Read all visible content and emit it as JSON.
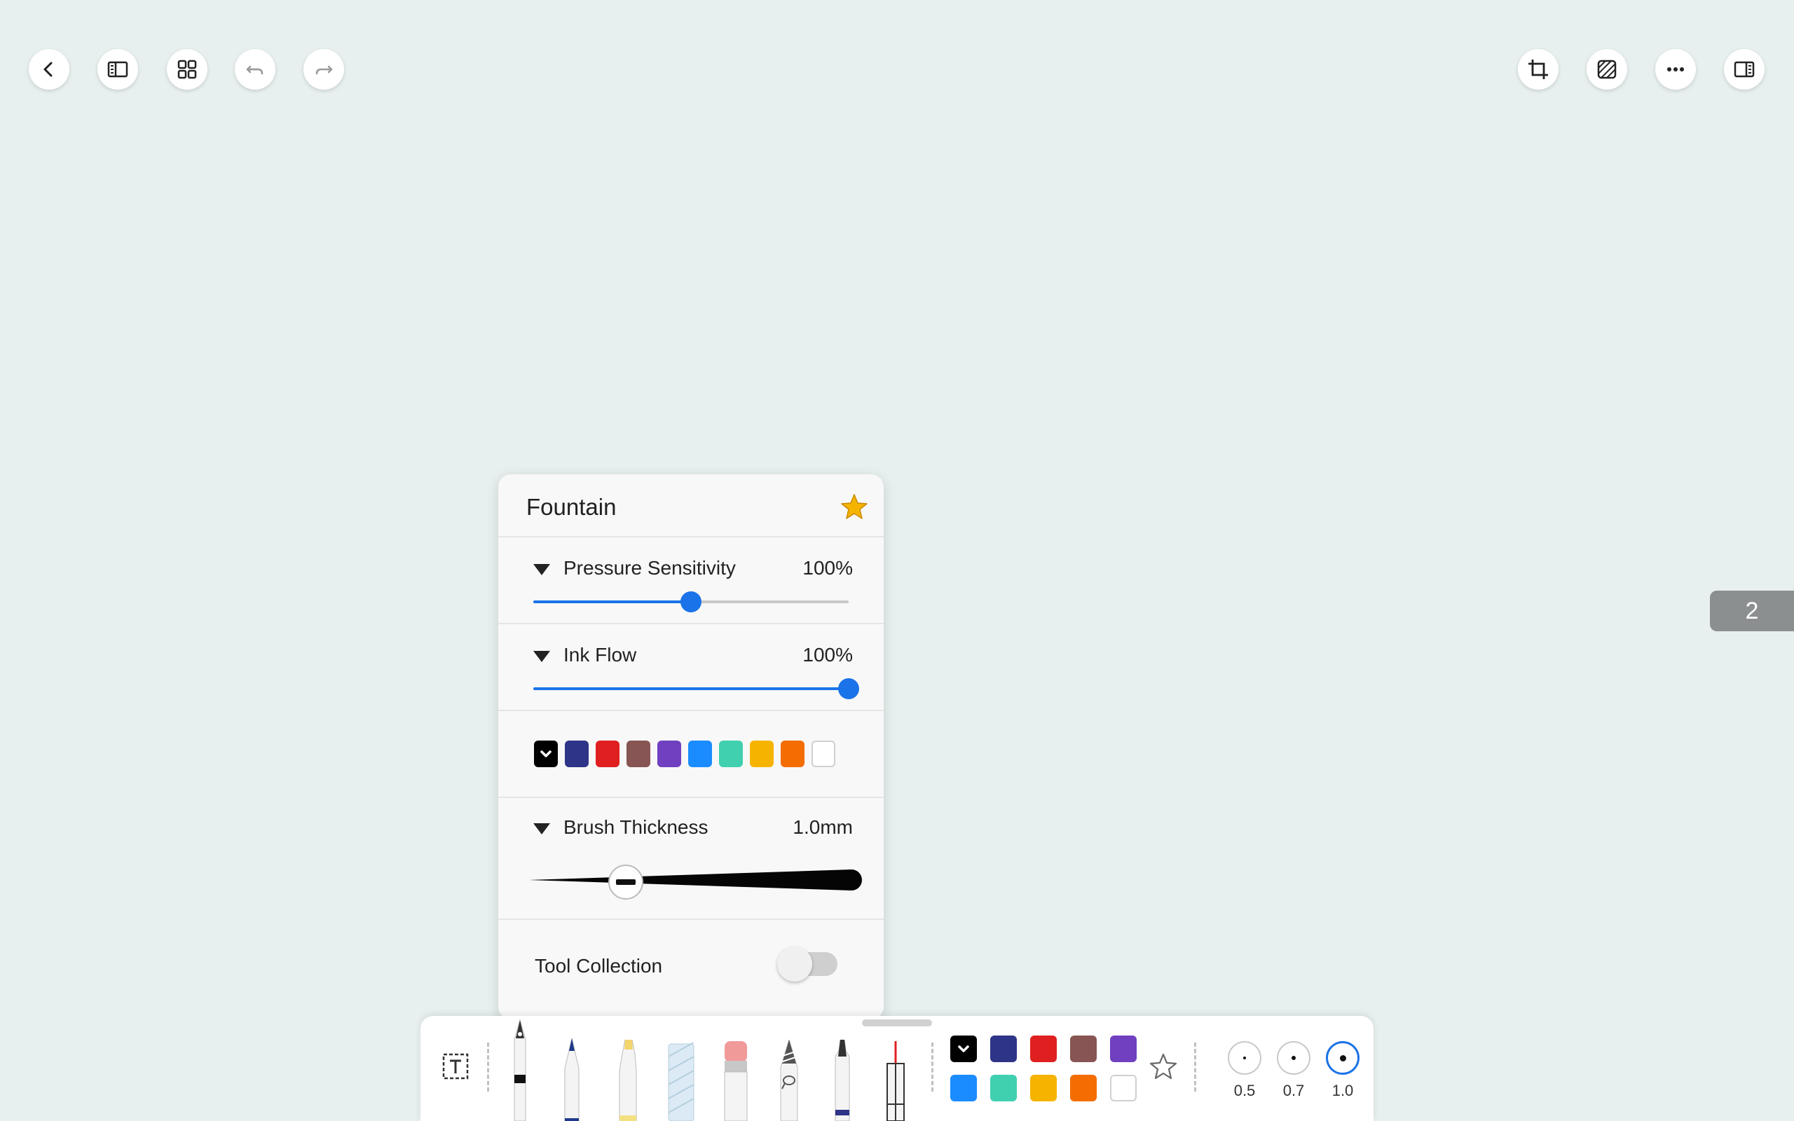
{
  "toolbar_left": [
    {
      "name": "back-icon"
    },
    {
      "name": "sidebar-toggle-icon"
    },
    {
      "name": "grid-view-icon"
    },
    {
      "name": "undo-icon"
    },
    {
      "name": "redo-icon"
    }
  ],
  "toolbar_right": [
    {
      "name": "crop-icon"
    },
    {
      "name": "pattern-icon"
    },
    {
      "name": "more-icon"
    },
    {
      "name": "split-view-icon"
    }
  ],
  "page_number": "2",
  "pen_panel": {
    "title": "Fountain",
    "favorite_icon": "star-icon",
    "pressure": {
      "label": "Pressure Sensitivity",
      "value": "100%",
      "level": 0.5
    },
    "ink_flow": {
      "label": "Ink Flow",
      "value": "100%",
      "level": 1.0
    },
    "colors": [
      "#000000",
      "#2e3487",
      "#e02020",
      "#875553",
      "#7040c0",
      "#1a8cff",
      "#40d0b0",
      "#f6b400",
      "#f46d00",
      "#ffffff"
    ],
    "selected_color": 0,
    "thickness": {
      "label": "Brush Thickness",
      "value": "1.0mm",
      "level": 0.3
    },
    "tool_collection": {
      "label": "Tool Collection",
      "enabled": false
    }
  },
  "dock": {
    "text_tool_icon": "text-box-icon",
    "tools": [
      "fountain-pen-icon",
      "ballpoint-pen-icon",
      "highlighter-icon",
      "ruler-icon",
      "eraser-icon",
      "lasso-pencil-icon",
      "marker-icon",
      "laser-pointer-icon"
    ],
    "colors_row1": [
      "#000000",
      "#2e3487",
      "#e02020",
      "#875553",
      "#7040c0"
    ],
    "colors_row2": [
      "#1a8cff",
      "#40d0b0",
      "#f6b400",
      "#f46d00",
      "#ffffff"
    ],
    "favorite_icon": "star-outline-icon",
    "sizes": [
      {
        "label": "0.5",
        "selected": false
      },
      {
        "label": "0.7",
        "selected": false
      },
      {
        "label": "1.0",
        "selected": true
      }
    ]
  }
}
